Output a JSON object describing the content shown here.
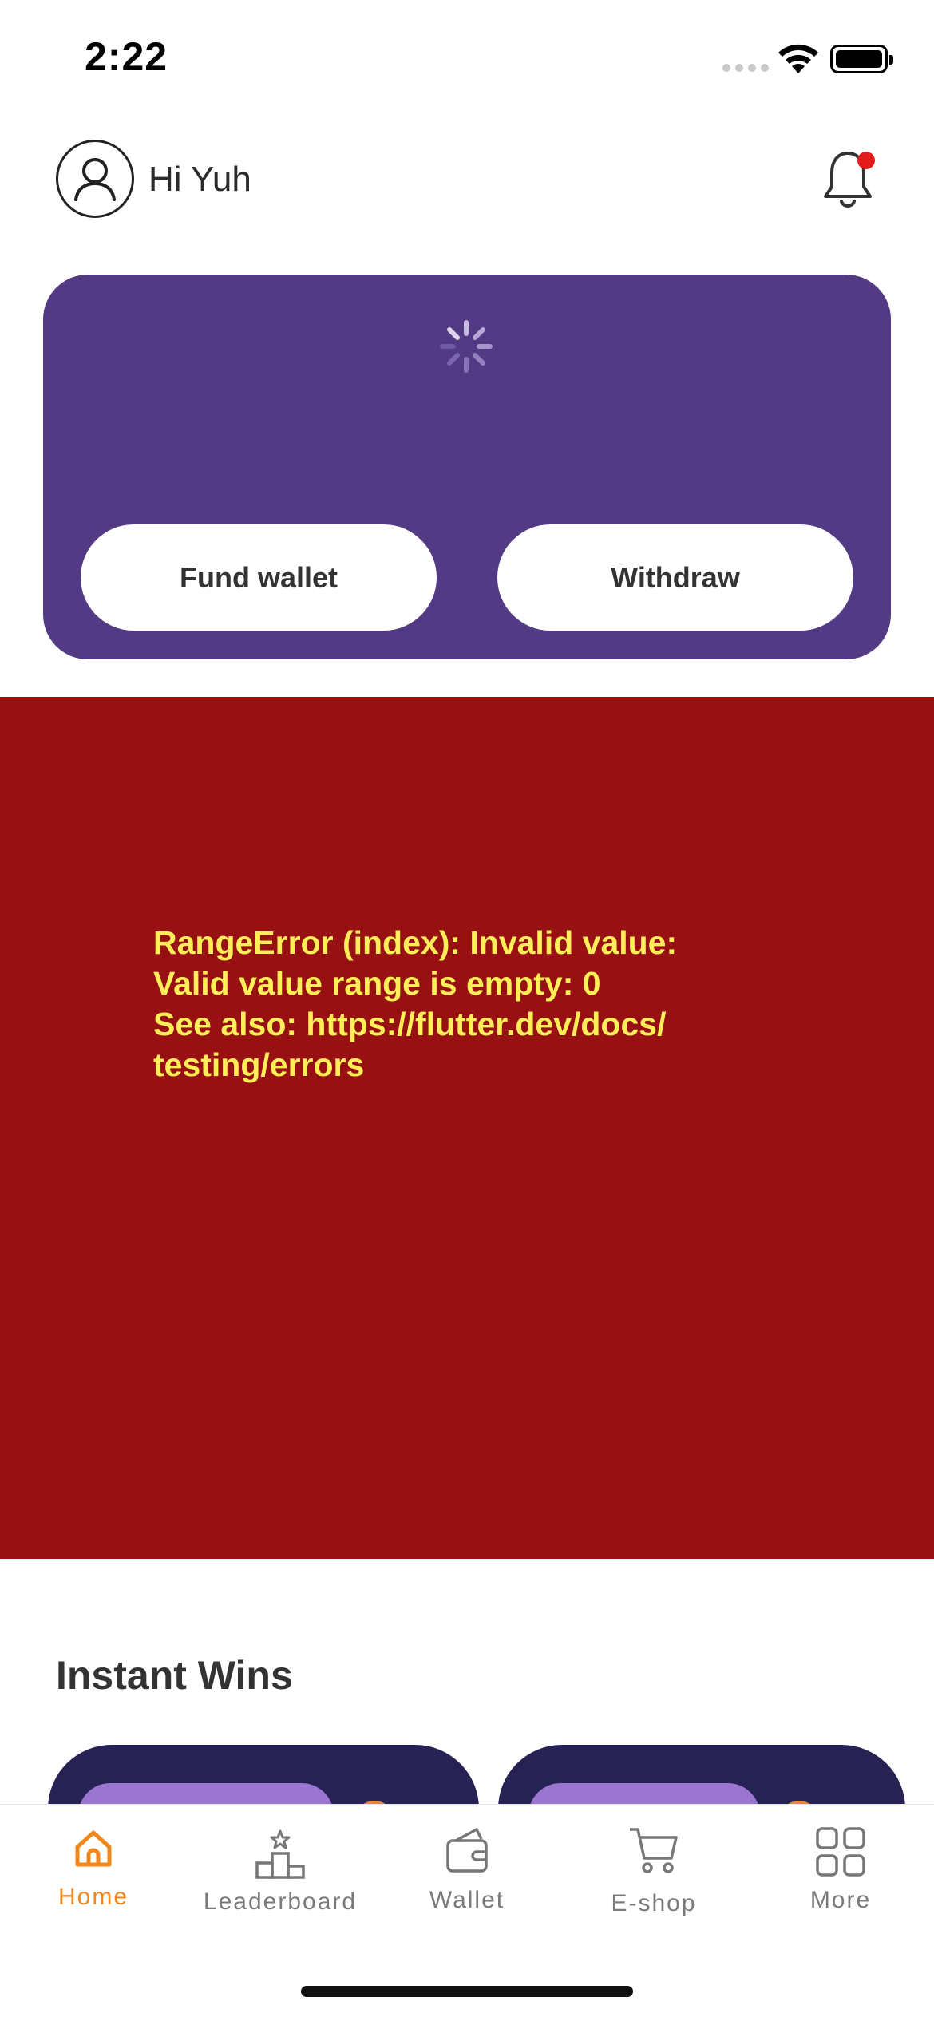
{
  "status_bar": {
    "time": "2:22"
  },
  "header": {
    "greeting": "Hi Yuh",
    "has_notification": true
  },
  "wallet_card": {
    "background": "#523a85",
    "fund_label": "Fund wallet",
    "withdraw_label": "Withdraw",
    "loading": true
  },
  "error": {
    "message": "RangeError (index): Invalid value:\nValid value range is empty: 0\nSee also: https://flutter.dev/docs/\ntesting/errors",
    "background": "#971012",
    "text_color": "#ffee58"
  },
  "instant_wins": {
    "title": "Instant Wins"
  },
  "bottom_nav": {
    "active_color": "#f0871c",
    "items": [
      {
        "label": "Home",
        "icon": "home-icon",
        "active": true
      },
      {
        "label": "Leaderboard",
        "icon": "podium-icon",
        "active": false
      },
      {
        "label": "Wallet",
        "icon": "wallet-icon",
        "active": false
      },
      {
        "label": "E-shop",
        "icon": "cart-icon",
        "active": false
      },
      {
        "label": "More",
        "icon": "grid-icon",
        "active": false
      }
    ]
  }
}
